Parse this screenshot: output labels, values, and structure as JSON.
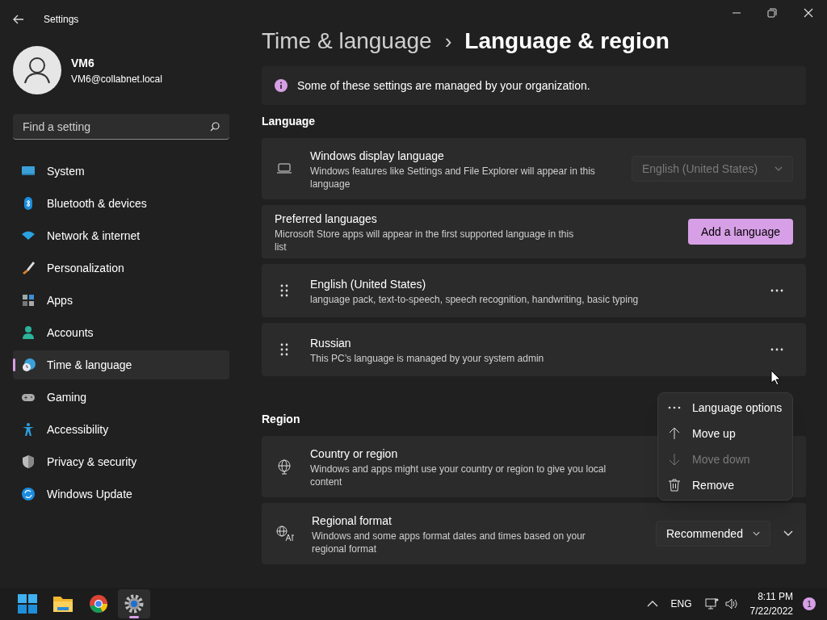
{
  "window": {
    "title": "Settings"
  },
  "profile": {
    "name": "VM6",
    "email": "VM6@collabnet.local"
  },
  "search": {
    "placeholder": "Find a setting"
  },
  "sidebar": {
    "items": [
      {
        "label": "System",
        "selected": false
      },
      {
        "label": "Bluetooth & devices",
        "selected": false
      },
      {
        "label": "Network & internet",
        "selected": false
      },
      {
        "label": "Personalization",
        "selected": false
      },
      {
        "label": "Apps",
        "selected": false
      },
      {
        "label": "Accounts",
        "selected": false
      },
      {
        "label": "Time & language",
        "selected": true
      },
      {
        "label": "Gaming",
        "selected": false
      },
      {
        "label": "Accessibility",
        "selected": false
      },
      {
        "label": "Privacy & security",
        "selected": false
      },
      {
        "label": "Windows Update",
        "selected": false
      }
    ]
  },
  "breadcrumb": {
    "parent": "Time & language",
    "separator": "›",
    "current": "Language & region"
  },
  "info_bar": {
    "text": "Some of these settings are managed by your organization."
  },
  "sections": [
    {
      "title": "Language",
      "cards": [
        {
          "kind": "display",
          "title": "Windows display language",
          "description": "Windows features like Settings and File Explorer will appear in this language",
          "value": "English (United States)",
          "disabled": true
        },
        {
          "kind": "preferred",
          "title": "Preferred languages",
          "description": "Microsoft Store apps will appear in the first supported language in this list",
          "button": "Add a language"
        },
        {
          "kind": "language",
          "title": "English (United States)",
          "description": "language pack, text-to-speech, speech recognition, handwriting, basic typing"
        },
        {
          "kind": "language",
          "title": "Russian",
          "description": "This PC’s language is managed by your system admin"
        }
      ]
    },
    {
      "title": "Region",
      "cards": [
        {
          "kind": "country",
          "title": "Country or region",
          "description": "Windows and apps might use your country or region to give you local content"
        },
        {
          "kind": "format",
          "title": "Regional format",
          "description": "Windows and some apps format dates and times based on your regional format",
          "value": "Recommended"
        }
      ]
    }
  ],
  "context_menu": {
    "items": [
      {
        "kind": "options",
        "label": "Language options",
        "disabled": false
      },
      {
        "kind": "up",
        "label": "Move up",
        "disabled": false
      },
      {
        "kind": "down",
        "label": "Move down",
        "disabled": true
      },
      {
        "kind": "remove",
        "label": "Remove",
        "disabled": false
      }
    ]
  },
  "taskbar": {
    "apps": [
      {
        "kind": "start",
        "selected": false
      },
      {
        "kind": "explorer",
        "selected": false
      },
      {
        "kind": "browser",
        "selected": false
      },
      {
        "kind": "settings",
        "selected": true
      }
    ],
    "language": "ENG",
    "time": "8:11 PM",
    "date": "7/22/2022",
    "notifications": "1"
  }
}
